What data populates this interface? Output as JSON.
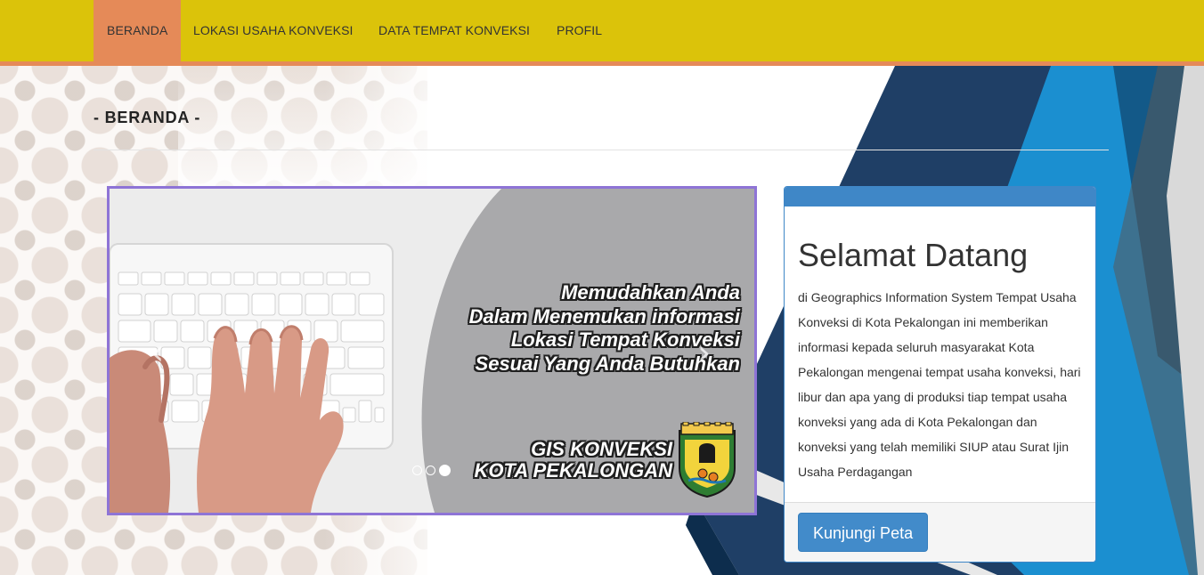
{
  "nav": {
    "items": [
      {
        "label": "BERANDA",
        "active": true
      },
      {
        "label": "LOKASI USAHA KONVEKSI",
        "active": false
      },
      {
        "label": "DATA TEMPAT KONVEKSI",
        "active": false
      },
      {
        "label": "PROFIL",
        "active": false
      }
    ]
  },
  "page": {
    "title": "- BERANDA -"
  },
  "carousel": {
    "slide_lines": [
      "Memudahkan Anda",
      "Dalam Menemukan informasi",
      "Lokasi Tempat Konveksi",
      "Sesuai Yang Anda Butuhkan"
    ],
    "brand_lines": [
      "GIS KONVEKSI",
      "KOTA PEKALONGAN"
    ],
    "prev_icon": "chevron-left-icon",
    "next_icon": "chevron-right-icon",
    "slide_count": 3,
    "active_slide": 3
  },
  "welcome": {
    "title": "Selamat Datang",
    "body": "di Geographics Information System Tempat Usaha Konveksi di Kota Pekalongan ini memberikan informasi kepada seluruh masyarakat Kota Pekalongan mengenai tempat usaha konveksi, hari libur dan apa yang di produksi tiap tempat usaha konveksi yang ada di Kota Pekalongan dan konveksi yang telah memiliki SIUP atau Surat Ijin Usaha Perdagangan",
    "button_label": "Kunjungi Peta"
  },
  "colors": {
    "navbar": "#dbc30a",
    "nav_active": "#e58a58",
    "carousel_border": "#8e74d6",
    "panel_primary": "#3f87c7",
    "button": "#428bca"
  }
}
